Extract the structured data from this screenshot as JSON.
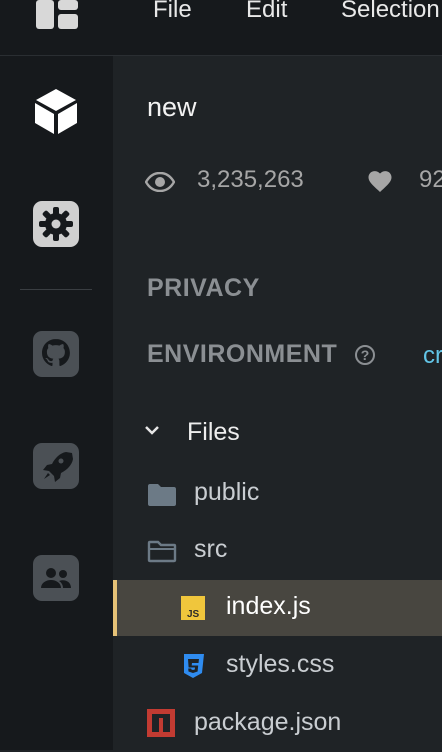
{
  "menu": {
    "items": [
      "File",
      "Edit",
      "Selection"
    ]
  },
  "activity": {
    "icons": [
      "cube-icon",
      "gear-icon",
      "github-icon",
      "rocket-icon",
      "people-icon"
    ]
  },
  "sandbox": {
    "title": "new",
    "views": "3,235,263",
    "likes": "92"
  },
  "sections": {
    "privacy": "PRIVACY",
    "environment": "ENVIRONMENT",
    "environment_value": "cr"
  },
  "files": {
    "header": "Files",
    "items": [
      {
        "name": "public",
        "icon": "folder-closed-icon",
        "active": false
      },
      {
        "name": "src",
        "icon": "folder-open-icon",
        "active": false
      },
      {
        "name": "index.js",
        "icon": "js-file-icon",
        "active": true
      },
      {
        "name": "styles.css",
        "icon": "css-file-icon",
        "active": false
      },
      {
        "name": "package.json",
        "icon": "npm-icon",
        "active": false
      }
    ]
  },
  "colors": {
    "active_row": "#484640",
    "active_accent": "#e6c277",
    "js_badge": "#f0c63c",
    "css_icon": "#2f8cf0",
    "npm_icon": "#c23b32",
    "env_link": "#62c4e6"
  }
}
